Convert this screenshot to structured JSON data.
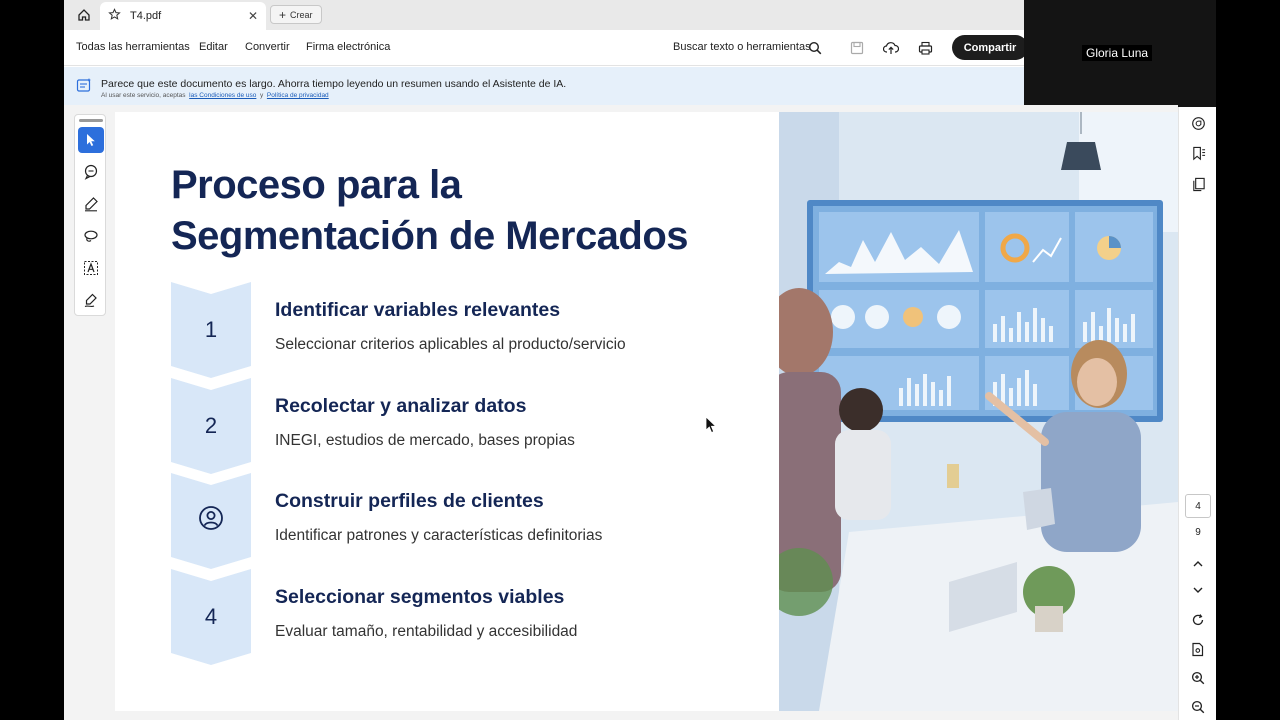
{
  "tabbar": {
    "tab_title": "T4.pdf",
    "tab_close": "✕",
    "crear_label": "Crear"
  },
  "menubar": {
    "items": [
      "Todas las herramientas",
      "Editar",
      "Convertir",
      "Firma electrónica"
    ],
    "search_label": "Buscar texto o herramientas",
    "share_label": "Compartir"
  },
  "banner": {
    "text": "Parece que este documento es largo. Ahorra tiempo leyendo un resumen usando el Asistente de IA.",
    "sub_prefix": "Al usar este servicio, aceptas",
    "terms_link": "las Condiciones de uso",
    "sub_and": "y",
    "privacy_link": "Política de privacidad"
  },
  "video": {
    "participant_name": "Gloria Luna"
  },
  "slide": {
    "title_line1": "Proceso para la",
    "title_line2": "Segmentación de Mercados",
    "steps": [
      {
        "marker": "1",
        "title": "Identificar variables relevantes",
        "desc": "Seleccionar criterios aplicables al producto/servicio"
      },
      {
        "marker": "2",
        "title": "Recolectar y analizar datos",
        "desc": "INEGI, estudios de mercado, bases propias"
      },
      {
        "marker": "user-circle-icon",
        "title": "Construir perfiles de clientes",
        "desc": "Identificar patrones y características definitorias"
      },
      {
        "marker": "4",
        "title": "Seleccionar segmentos viables",
        "desc": "Evaluar tamaño, rentabilidad y accesibilidad"
      }
    ]
  },
  "pager": {
    "current_page": "4",
    "total_pages": "9"
  },
  "colors": {
    "title_navy": "#142655",
    "chevron_fill": "#d8e7f8",
    "active_tool": "#2d6fdc",
    "banner_bg": "#e6f0fa"
  }
}
